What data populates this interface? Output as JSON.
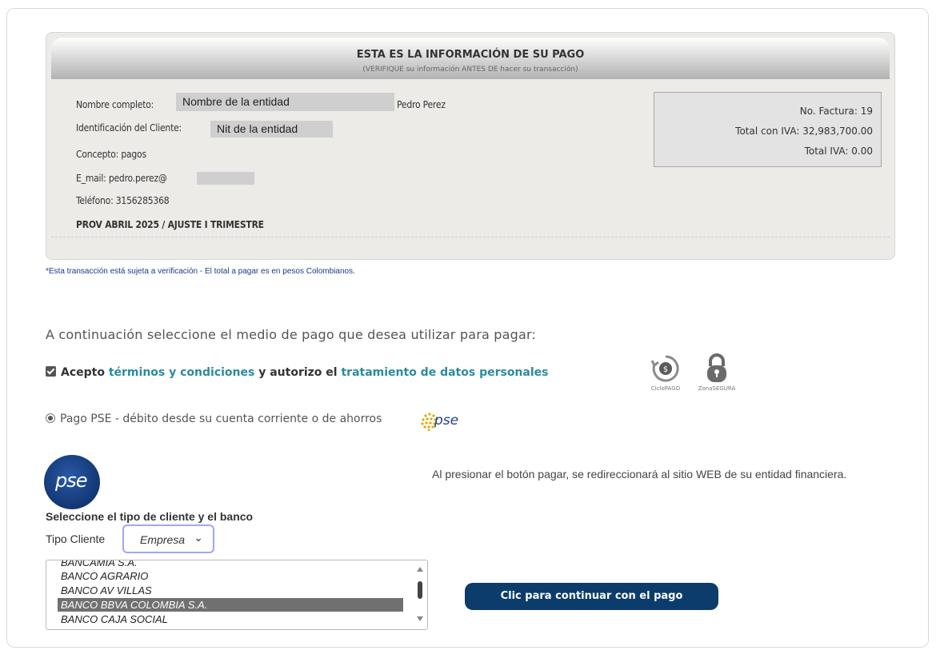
{
  "header": {
    "title": "ESTA ES LA INFORMACIÓN DE SU PAGO",
    "subtitle": "(VERIFIQUE su información ANTES DE hacer su transacción)"
  },
  "client": {
    "name_label": "Nombre completo:",
    "name_masked": "Nombre de la entidad",
    "name_value": "Pedro Perez",
    "id_label": "Identificación del Cliente:",
    "id_masked": "Nit de la entidad",
    "concept": "Concepto: pagos",
    "email": "E_mail: pedro.perez@",
    "phone": "Teléfono: 3156285368",
    "period": "PROV ABRIL 2025 / AJUSTE I TRIMESTRE"
  },
  "summary": {
    "invoice": "No. Factura: 19",
    "total_with_tax": "Total con IVA: 32,983,700.00",
    "total_tax": "Total IVA: 0.00"
  },
  "note": "*Esta transacción está sujeta a verificación - El total a pagar es en pesos Colombianos.",
  "instruction": "A continuación seleccione el medio de pago que desea utilizar para pagar:",
  "consent": {
    "prefix": "Acepto",
    "terms_link": "términos y condiciones",
    "middle": "y autorizo el",
    "data_link": "tratamiento de datos personales",
    "checked": true
  },
  "badges": {
    "ciclo": "CicloPAGO",
    "zona": "ZonaSEGURA"
  },
  "payment_option": {
    "label": "Pago PSE - débito desde su cuenta corriente o de ahorros",
    "logo_text": "pse",
    "selected": true
  },
  "bank_selection": {
    "title": "Seleccione el tipo de cliente y el banco",
    "tipo_label": "Tipo Cliente",
    "tipo_value": "Empresa",
    "banks": [
      "BANCAMIA S.A.",
      "BANCO AGRARIO",
      "BANCO AV VILLAS",
      "BANCO BBVA COLOMBIA S.A.",
      "BANCO CAJA SOCIAL"
    ],
    "selected_bank": "BANCO BBVA COLOMBIA S.A."
  },
  "redirect_note": "Al presionar el botón pagar, se redireccionará al sitio WEB de su entidad financiera.",
  "pay_button": "Clic para continuar con el pago",
  "colors": {
    "link": "#2b8aa0",
    "button": "#0c3c6b",
    "note": "#1a3a8a",
    "pse_gold": "#e0a800"
  }
}
